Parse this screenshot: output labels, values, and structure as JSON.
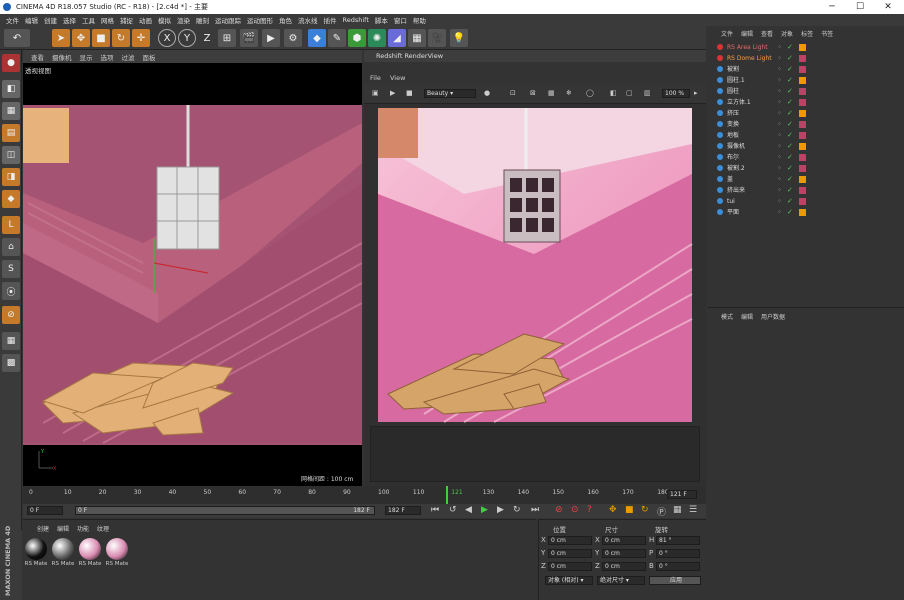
{
  "window": {
    "title": "CINEMA 4D R18.057 Studio (RC - R18) - [2.c4d *] - 主要"
  },
  "menu": [
    "文件",
    "编辑",
    "创建",
    "选择",
    "工具",
    "网格",
    "捕捉",
    "动画",
    "模拟",
    "渲染",
    "雕刻",
    "运动跟踪",
    "运动图形",
    "角色",
    "流水线",
    "插件",
    "Redshift",
    "脚本",
    "窗口",
    "帮助"
  ],
  "toolbar": {
    "undo_icon": "undo-icon",
    "axes": [
      "X",
      "Y",
      "Z"
    ]
  },
  "viewport": {
    "menu": [
      "查看",
      "摄像机",
      "显示",
      "选项",
      "过滤",
      "面板"
    ],
    "label": "透视视图",
    "grid_info": "网格间距 : 100 cm"
  },
  "renderview": {
    "title": "Redshift RenderView",
    "menu": [
      "File",
      "View"
    ],
    "aov": "Beauty",
    "zoom": "100 %"
  },
  "object_manager": {
    "menu": [
      "文件",
      "编辑",
      "查看",
      "对象",
      "标签",
      "书签"
    ],
    "objects": [
      {
        "name": "RS Area Light",
        "color": "#e86a6a",
        "hl": false
      },
      {
        "name": "RS Dome Light",
        "color": "#ff9e3d",
        "hl": true
      },
      {
        "name": "被割",
        "color": "#ddd",
        "hl": false
      },
      {
        "name": "圆柱.1",
        "color": "#ddd",
        "hl": false
      },
      {
        "name": "圆柱",
        "color": "#ddd",
        "hl": false
      },
      {
        "name": "立方体.1",
        "color": "#ddd",
        "hl": false
      },
      {
        "name": "挤压",
        "color": "#ddd",
        "hl": false
      },
      {
        "name": "变换",
        "color": "#ddd",
        "hl": false
      },
      {
        "name": "地板",
        "color": "#ddd",
        "hl": false
      },
      {
        "name": "摄像机",
        "color": "#ddd",
        "hl": false
      },
      {
        "name": "布尔",
        "color": "#ddd",
        "hl": false
      },
      {
        "name": "被割.2",
        "color": "#ddd",
        "hl": false
      },
      {
        "name": "盖",
        "color": "#ddd",
        "hl": false
      },
      {
        "name": "挤出来",
        "color": "#ddd",
        "hl": false
      },
      {
        "name": "tui",
        "color": "#ddd",
        "hl": false
      },
      {
        "name": "平面",
        "color": "#ddd",
        "hl": false
      }
    ]
  },
  "attribute_manager": {
    "menu": [
      "模式",
      "编辑",
      "用户数据"
    ]
  },
  "timeline": {
    "ticks": [
      "0",
      "10",
      "20",
      "30",
      "40",
      "50",
      "60",
      "70",
      "80",
      "90",
      "100",
      "110",
      "121",
      "130",
      "140",
      "150",
      "160",
      "170",
      "180"
    ],
    "current_frame": "121 F",
    "start": "0 F",
    "end_field": "182 F",
    "end": "182 F",
    "second_start": "0 F"
  },
  "materials": {
    "menu": [
      "创建",
      "编辑",
      "功能",
      "纹理"
    ],
    "items": [
      "RS Mate",
      "RS Mate",
      "RS Mate",
      "RS Mate"
    ]
  },
  "coords": {
    "headers": [
      "位置",
      "尺寸",
      "旋转"
    ],
    "rows": [
      {
        "axis": "X",
        "pos": "0 cm",
        "sizeaxis": "X",
        "size": "0 cm",
        "rotaxis": "H",
        "rot": "81 °"
      },
      {
        "axis": "Y",
        "pos": "0 cm",
        "sizeaxis": "Y",
        "size": "0 cm",
        "rotaxis": "P",
        "rot": "0 °"
      },
      {
        "axis": "Z",
        "pos": "0 cm",
        "sizeaxis": "Z",
        "size": "0 cm",
        "rotaxis": "B",
        "rot": "0 °"
      }
    ],
    "mode": "对象 (相对)",
    "size_mode": "绝对尺寸",
    "apply": "应用"
  },
  "brand": "MAXON CINEMA 4D"
}
